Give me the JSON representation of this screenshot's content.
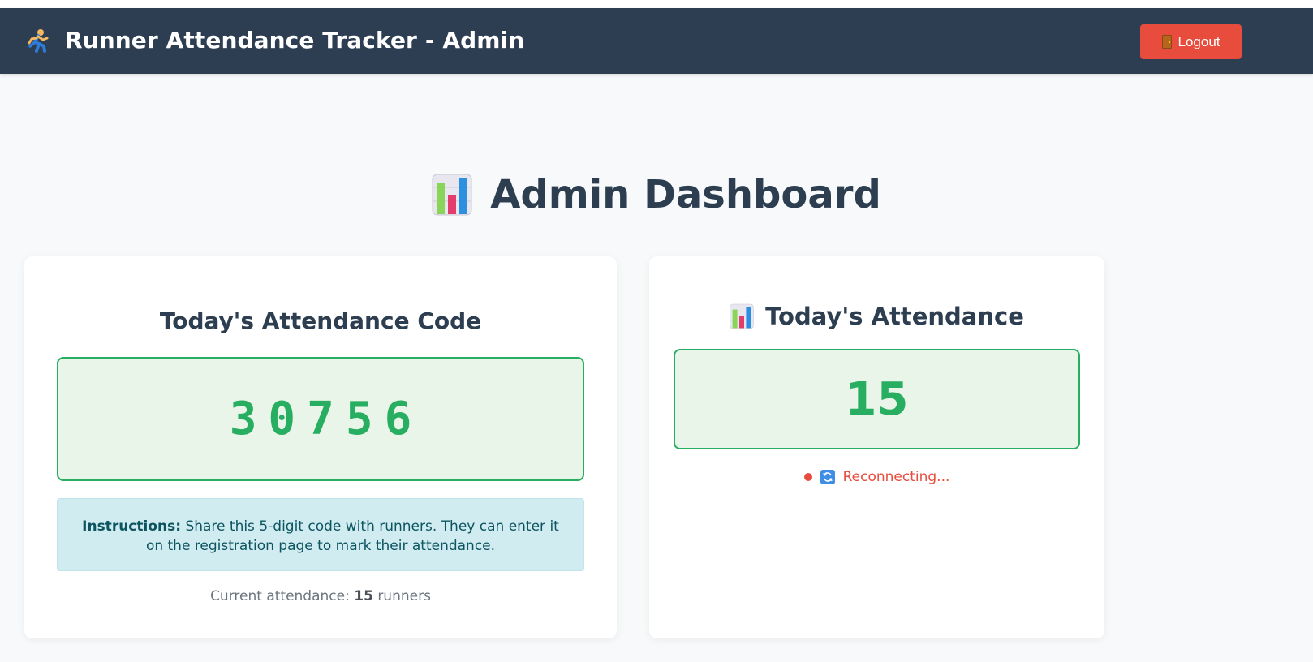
{
  "header": {
    "title": "Runner Attendance Tracker - Admin",
    "logout_label": "Logout",
    "icon": "runner-icon"
  },
  "page": {
    "title": "Admin Dashboard",
    "icon": "bar-chart-icon"
  },
  "code_card": {
    "title": "Today's Attendance Code",
    "code": "30756",
    "instructions_label": "Instructions:",
    "instructions_text": "Share this 5-digit code with runners. They can enter it on the registration page to mark their attendance.",
    "current_prefix": "Current attendance:",
    "current_count": "15",
    "current_suffix": "runners"
  },
  "attendance_card": {
    "title": "Today's Attendance",
    "count": "15",
    "status_text": "Reconnecting..."
  },
  "colors": {
    "navbar": "#2e3e52",
    "accent_green": "#27ae60",
    "danger_red": "#e74c3c",
    "info_bg": "#d1ecf1"
  }
}
